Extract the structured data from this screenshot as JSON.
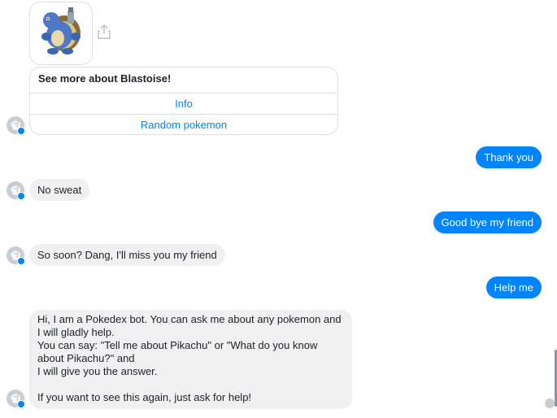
{
  "pokemon_card": {
    "image_alt": "Blastoise",
    "title": "See more about Blastoise!",
    "buttons": [
      "Info",
      "Random pokemon"
    ]
  },
  "messages": [
    {
      "from": "user",
      "text": "Thank you"
    },
    {
      "from": "bot",
      "text": "No sweat"
    },
    {
      "from": "user",
      "text": "Good bye my friend"
    },
    {
      "from": "bot",
      "text": "So soon? Dang, I'll miss you my friend"
    },
    {
      "from": "user",
      "text": "Help me"
    },
    {
      "from": "bot",
      "text": "Hi, I am a Pokedex bot. You can ask me about any pokemon and\nI will gladly help.\nYou can say: \"Tell me about Pikachu\" or \"What do you know\nabout Pikachu?\" and\nI will give you the answer.\n\nIf you want to see this again, just ask for help!"
    }
  ],
  "colors": {
    "accent": "#0084ff",
    "bubble_incoming": "#f1f0f0",
    "border": "#dddfe2"
  },
  "icons": [
    "bot-avatar-icon",
    "share-icon",
    "messenger-badge-icon",
    "seen-avatar-icon"
  ]
}
